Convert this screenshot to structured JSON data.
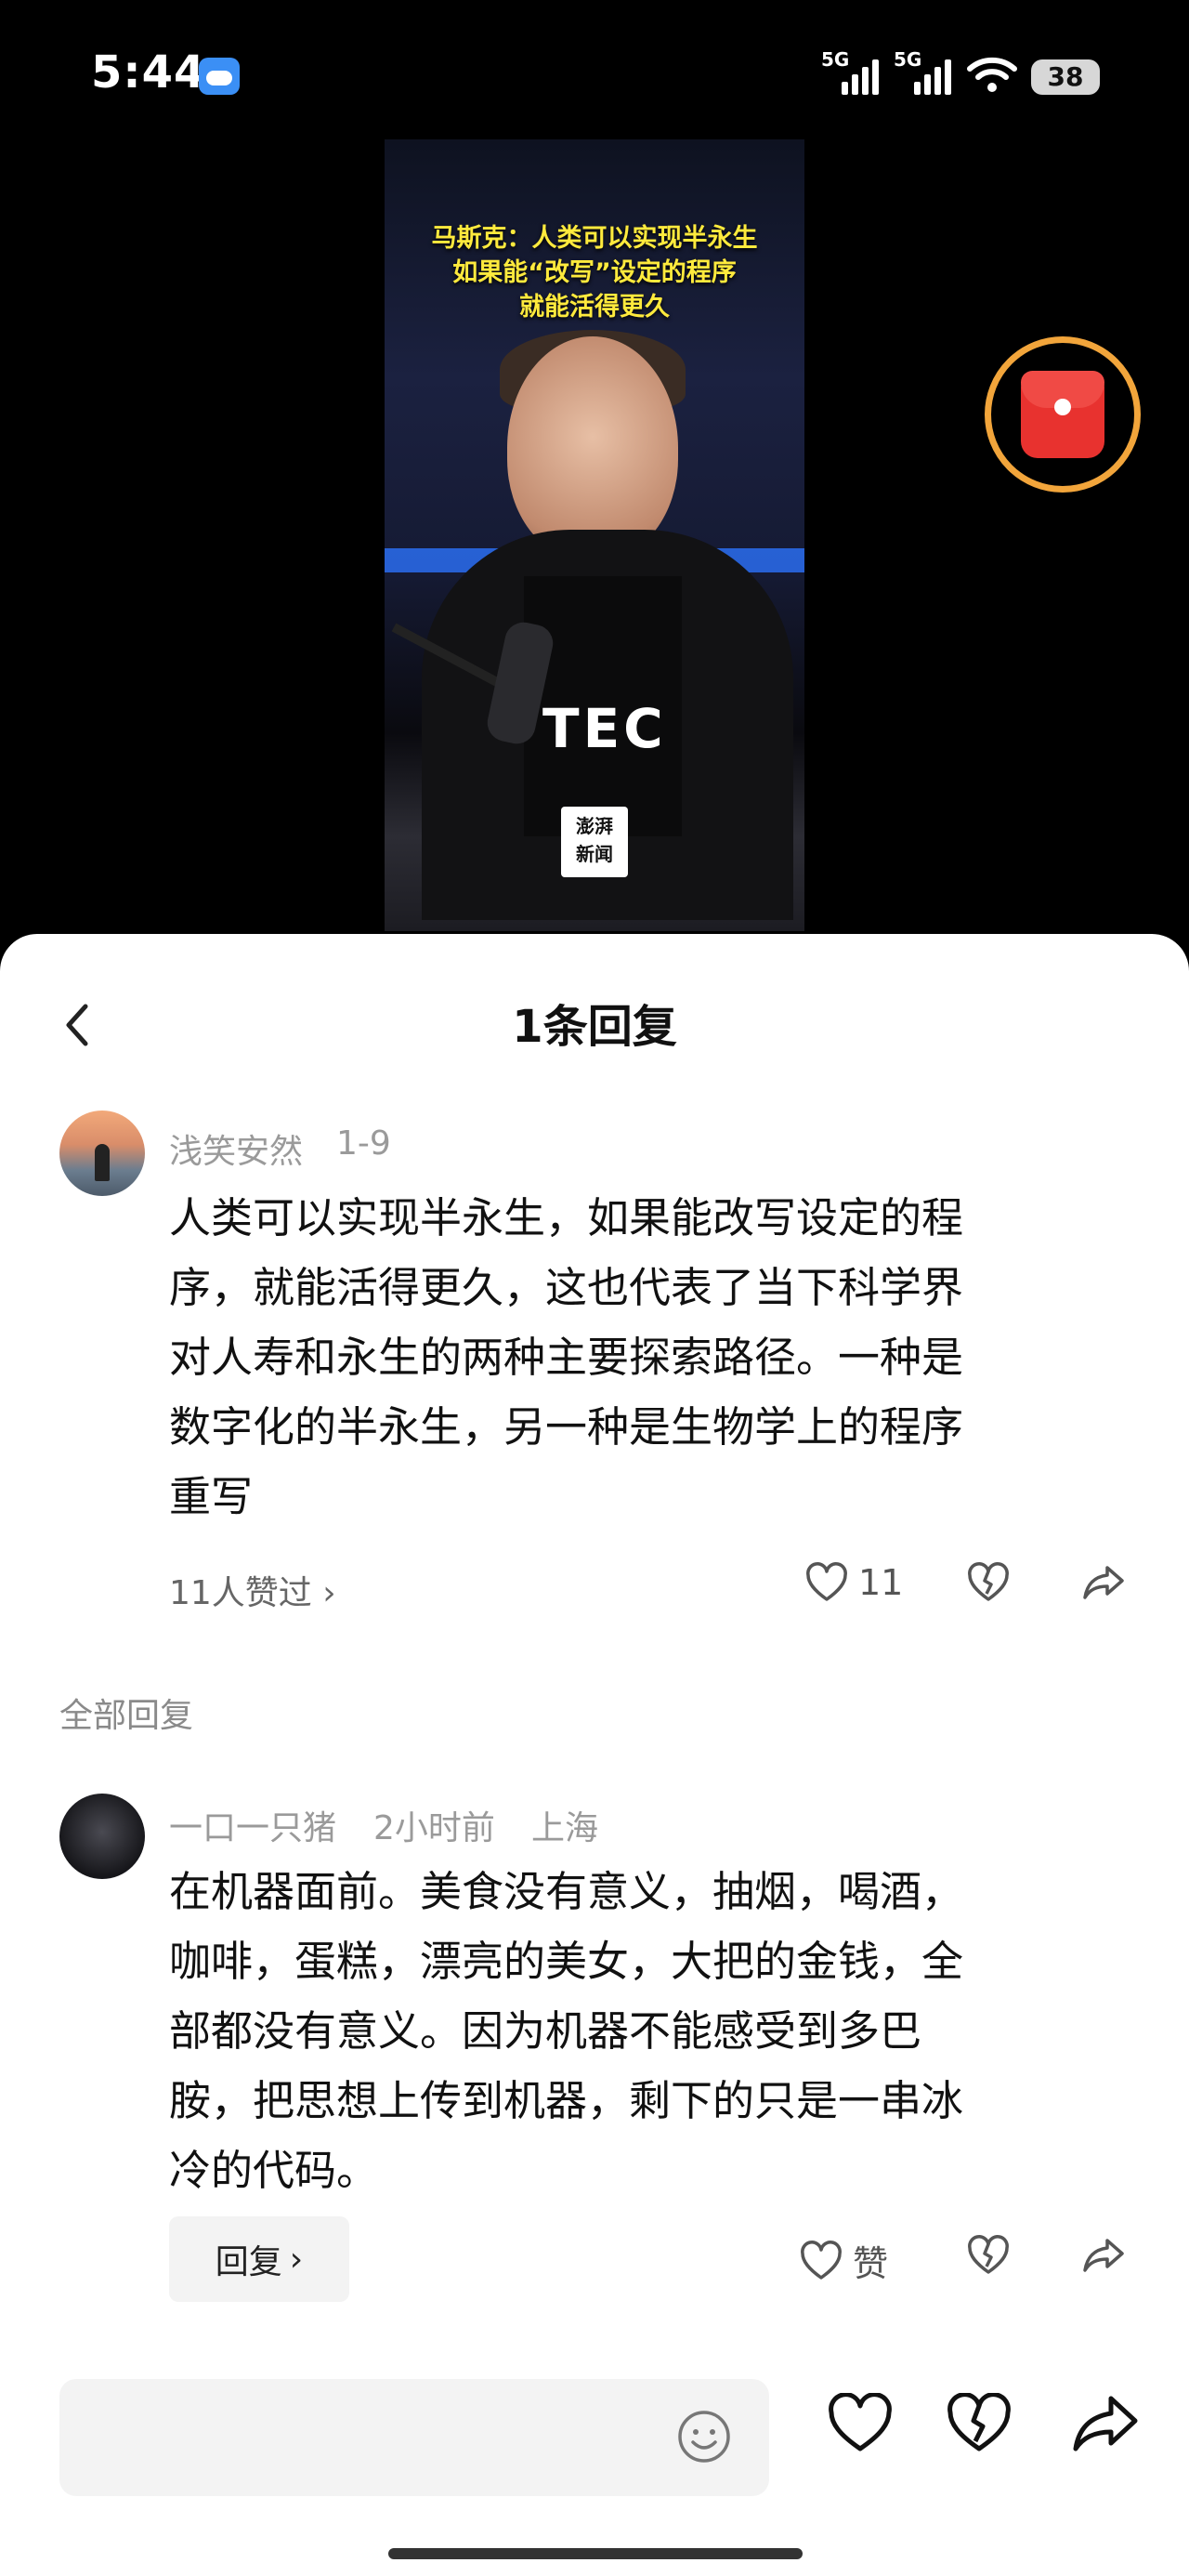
{
  "status_bar": {
    "time": "5:44",
    "network1": "5G",
    "network2": "5G",
    "battery": "38",
    "icons": [
      "weather-icon",
      "signal-icon",
      "wifi-icon",
      "battery-icon"
    ]
  },
  "video": {
    "caption_lines": [
      "马斯克：人类可以实现半永生",
      "如果能“改写”设定的程序",
      "就能活得更久"
    ],
    "tee_text": "TEC",
    "logo_lines": [
      "澎湃",
      "新闻"
    ]
  },
  "sheet": {
    "title": "1条回复",
    "back_icon": "chevron-left-icon"
  },
  "main_comment": {
    "author": "浅笑安然",
    "date": "1-9",
    "lines": [
      "人类可以实现半永生，如果能改写设定的程",
      "序，就能活得更久，这也代表了当下科学界",
      "对人寿和永生的两种主要探索路径。一种是",
      "数字化的半永生，另一种是生物学上的程序",
      "重写"
    ],
    "likes_summary": "11人赞过",
    "like_count": "11"
  },
  "section_label": "全部回复",
  "reply": {
    "author": "一口一只猪",
    "time": "2小时前",
    "location": "上海",
    "lines": [
      "在机器面前。美食没有意义，抽烟，喝酒，",
      "咖啡，蛋糕，漂亮的美女，大把的金钱，全",
      "部都没有意义。因为机器不能感受到多巴",
      "胺，把思想上传到机器，剩下的只是一串冰",
      "冷的代码。"
    ],
    "like_label": "赞",
    "reply_label": "回复"
  },
  "colors": {
    "accent_orange": "#f2a53b",
    "red_packet": "#e8322f",
    "caption_yellow": "#ffea3d"
  }
}
